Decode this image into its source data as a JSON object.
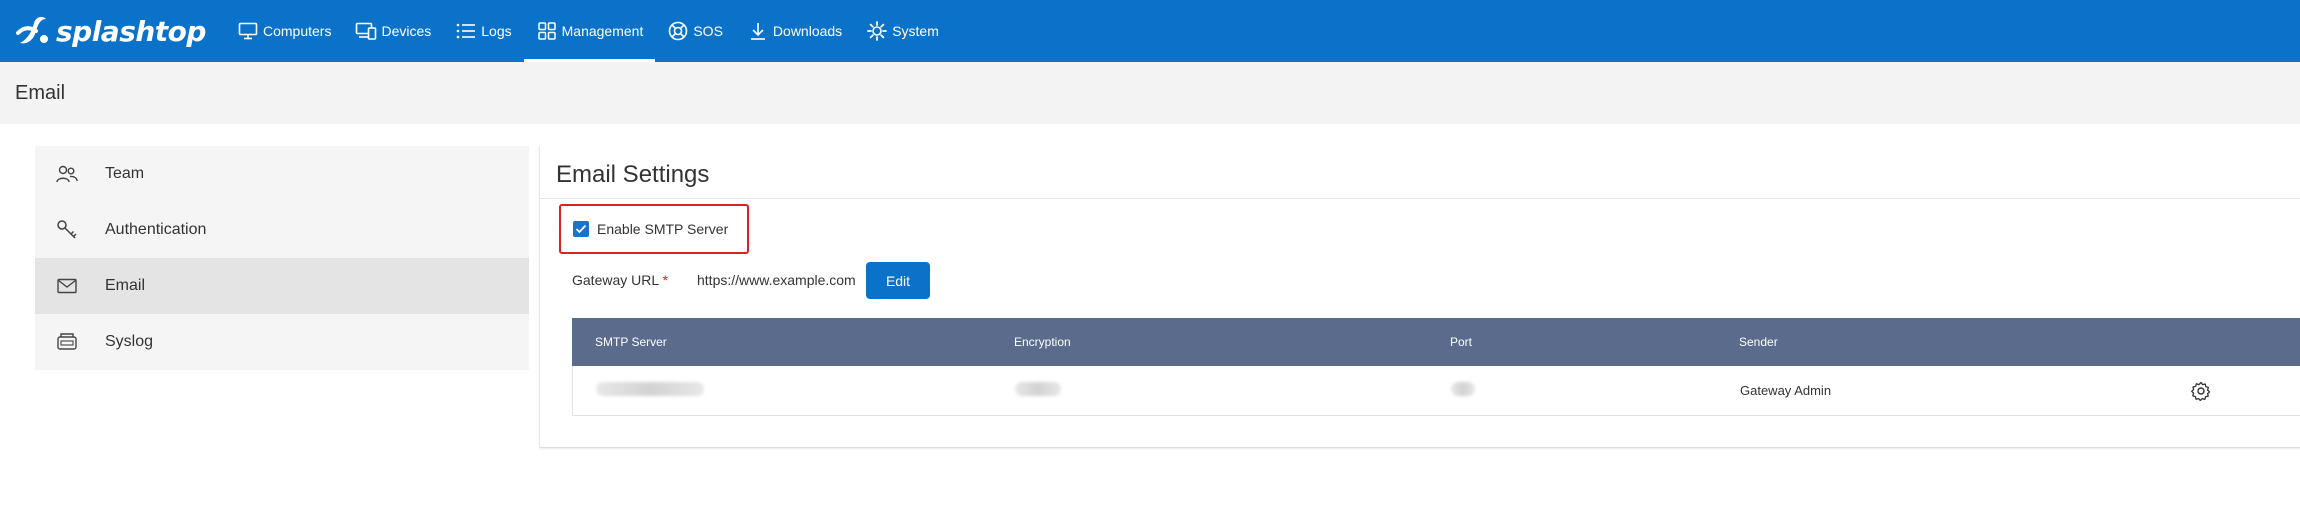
{
  "brand": {
    "name": "splashtop",
    "accent": "#0a73c9"
  },
  "nav": {
    "items": [
      {
        "label": "Computers",
        "icon": "monitor-icon"
      },
      {
        "label": "Devices",
        "icon": "devices-icon"
      },
      {
        "label": "Logs",
        "icon": "list-icon"
      },
      {
        "label": "Management",
        "icon": "grid-icon",
        "active": true
      },
      {
        "label": "SOS",
        "icon": "sos-icon"
      },
      {
        "label": "Downloads",
        "icon": "download-icon"
      },
      {
        "label": "System",
        "icon": "gear-icon"
      }
    ]
  },
  "page": {
    "title": "Email"
  },
  "sidebar": {
    "items": [
      {
        "label": "Team",
        "icon": "team-icon"
      },
      {
        "label": "Authentication",
        "icon": "key-icon"
      },
      {
        "label": "Email",
        "icon": "mail-icon",
        "active": true
      },
      {
        "label": "Syslog",
        "icon": "log-icon"
      }
    ]
  },
  "panel": {
    "title": "Email Settings",
    "smtp_checkbox_label": "Enable SMTP Server",
    "smtp_enabled": true,
    "gateway_label": "Gateway URL",
    "gateway_required": "*",
    "gateway_url": "https://www.example.com",
    "edit_label": "Edit"
  },
  "table": {
    "headers": [
      "SMTP Server",
      "Encryption",
      "Port",
      "Sender"
    ],
    "rows": [
      {
        "smtp_server": "",
        "encryption": "",
        "port": "",
        "sender": "Gateway Admin"
      }
    ]
  }
}
